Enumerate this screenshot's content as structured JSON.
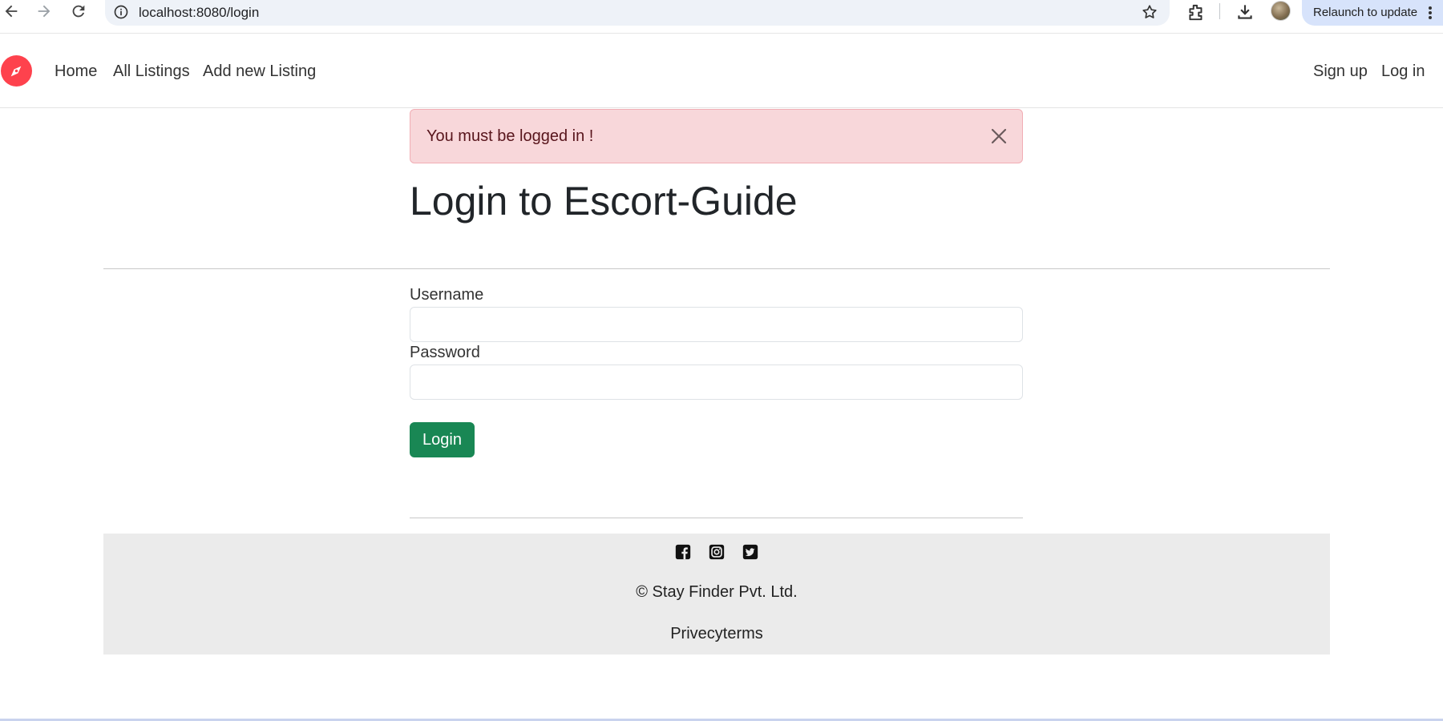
{
  "browser": {
    "url": "localhost:8080/login",
    "relaunch_label": "Relaunch to update"
  },
  "navbar": {
    "links_left": [
      "Home",
      "All Listings",
      "Add new Listing"
    ],
    "links_right": [
      "Sign up",
      "Log in"
    ],
    "brand_color": "#fe424d"
  },
  "alert": {
    "message": "You must be logged in !"
  },
  "page": {
    "title": "Login to Escort-Guide"
  },
  "form": {
    "username_label": "Username",
    "username_value": "",
    "password_label": "Password",
    "password_value": "",
    "submit_label": "Login",
    "submit_color": "#198754"
  },
  "footer": {
    "social_icons": [
      "facebook-icon",
      "instagram-icon",
      "twitter-icon"
    ],
    "copyright": "© Stay Finder Pvt. Ltd.",
    "links": "Privecyterms"
  }
}
